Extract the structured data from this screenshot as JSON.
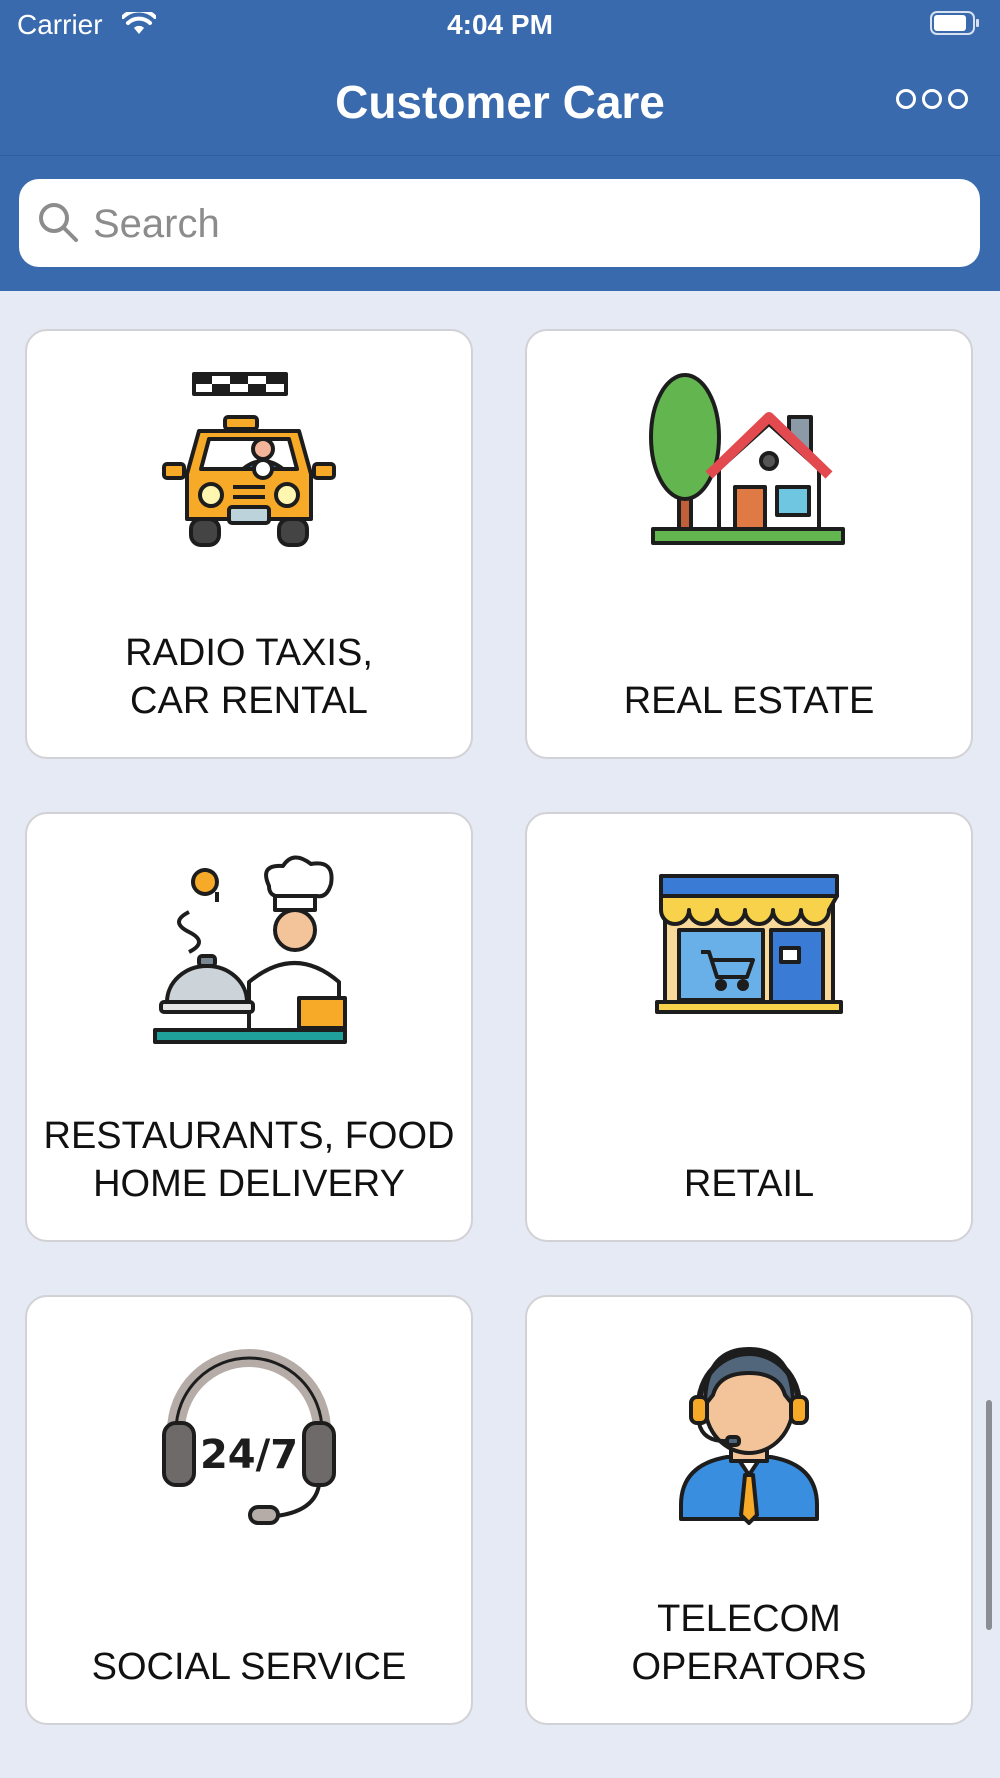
{
  "status_bar": {
    "carrier": "Carrier",
    "time": "4:04 PM"
  },
  "nav": {
    "title": "Customer Care",
    "more_icon": "more-icon"
  },
  "search": {
    "placeholder": "Search",
    "value": ""
  },
  "categories": [
    {
      "label": "RADIO TAXIS,\nCAR RENTAL",
      "icon": "taxi-icon"
    },
    {
      "label": "REAL ESTATE",
      "icon": "house-icon"
    },
    {
      "label": "RESTAURANTS, FOOD\nHOME DELIVERY",
      "icon": "chef-icon"
    },
    {
      "label": "RETAIL",
      "icon": "store-icon"
    },
    {
      "label": "SOCIAL SERVICE",
      "icon": "headset-icon"
    },
    {
      "label": "TELECOM\nOPERATORS",
      "icon": "operator-icon"
    }
  ],
  "colors": {
    "header": "#3a6aae",
    "background": "#e6eaf4",
    "card": "#ffffff"
  }
}
